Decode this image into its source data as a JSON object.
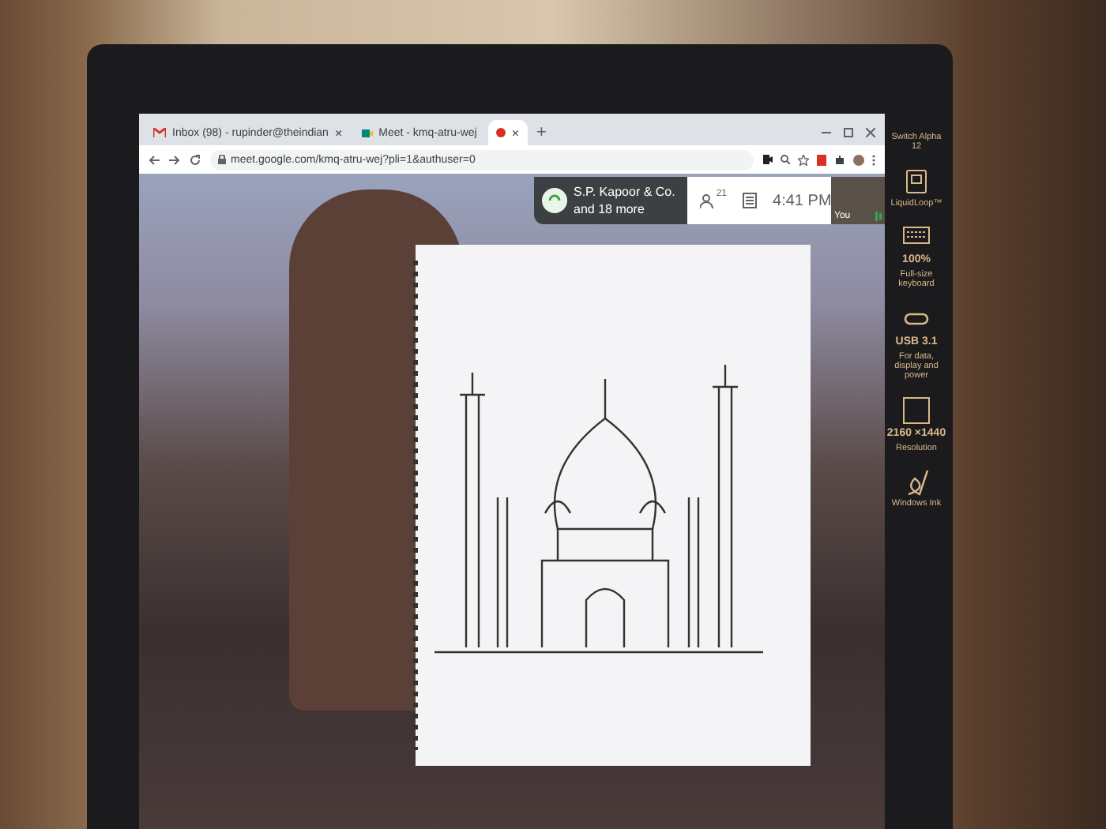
{
  "browser": {
    "tabs": [
      {
        "title": "Inbox (98) - rupinder@theindian",
        "kind": "mail",
        "close": "×",
        "selected": false
      },
      {
        "title": "Meet - kmq-atru-wej",
        "kind": "meet",
        "selected": false
      },
      {
        "kind": "record",
        "close": "×",
        "selected": true
      }
    ],
    "new_tab": "+",
    "url": "meet.google.com/kmq-atru-wej?pli=1&authuser=0"
  },
  "meeting": {
    "name": "S.P. Kapoor & Co.",
    "subtitle": "and 18 more",
    "participant_count": "21",
    "time": "4:41 PM",
    "self_label": "You"
  },
  "stickers": [
    {
      "kind": "brand",
      "title": "Switch Alpha 12"
    },
    {
      "kind": "cpu",
      "title": "LiquidLoop™"
    },
    {
      "kind": "keyboard",
      "title": "100%",
      "caption": "Full-size keyboard"
    },
    {
      "kind": "usb",
      "title": "USB 3.1",
      "caption": "For data, display and power"
    },
    {
      "kind": "resolution",
      "title": "2160 ×1440",
      "caption": "Resolution"
    },
    {
      "kind": "pen",
      "caption": "Windows Ink"
    }
  ]
}
